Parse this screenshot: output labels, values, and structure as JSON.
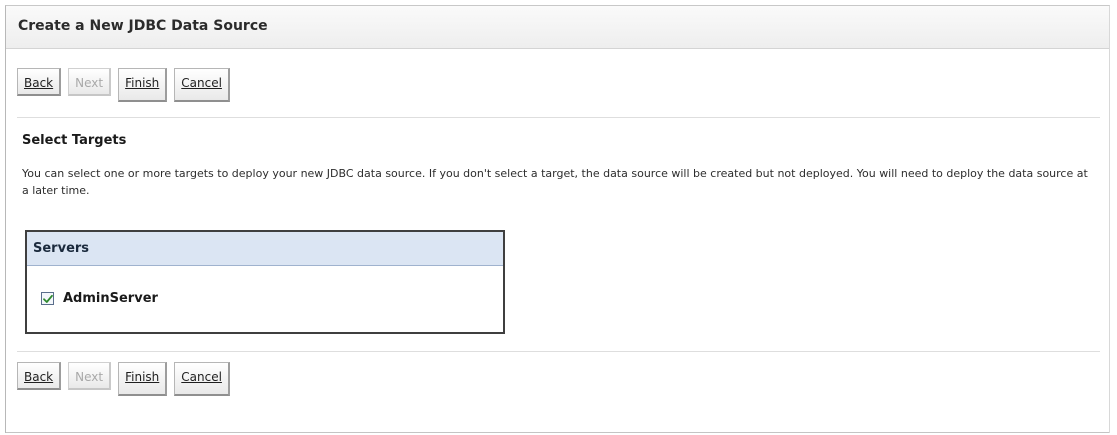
{
  "page": {
    "title": "Create a New JDBC Data Source"
  },
  "buttons": {
    "back": "Back",
    "next": "Next",
    "finish": "Finish",
    "cancel": "Cancel"
  },
  "section": {
    "title": "Select Targets",
    "description": "You can select one or more targets to deploy your new JDBC data source. If you don't select a target, the data source will be created but not deployed. You will need to deploy the data source at a later time."
  },
  "servers": {
    "header": "Servers",
    "items": [
      {
        "label": "AdminServer",
        "checked": true
      }
    ]
  },
  "icons": {
    "checkbox_checked": "checkmark-icon"
  },
  "colors": {
    "servers_header_bg": "#dbe5f3",
    "checkmark": "#2f8a2f",
    "disabled_text": "#a9a9a9"
  }
}
